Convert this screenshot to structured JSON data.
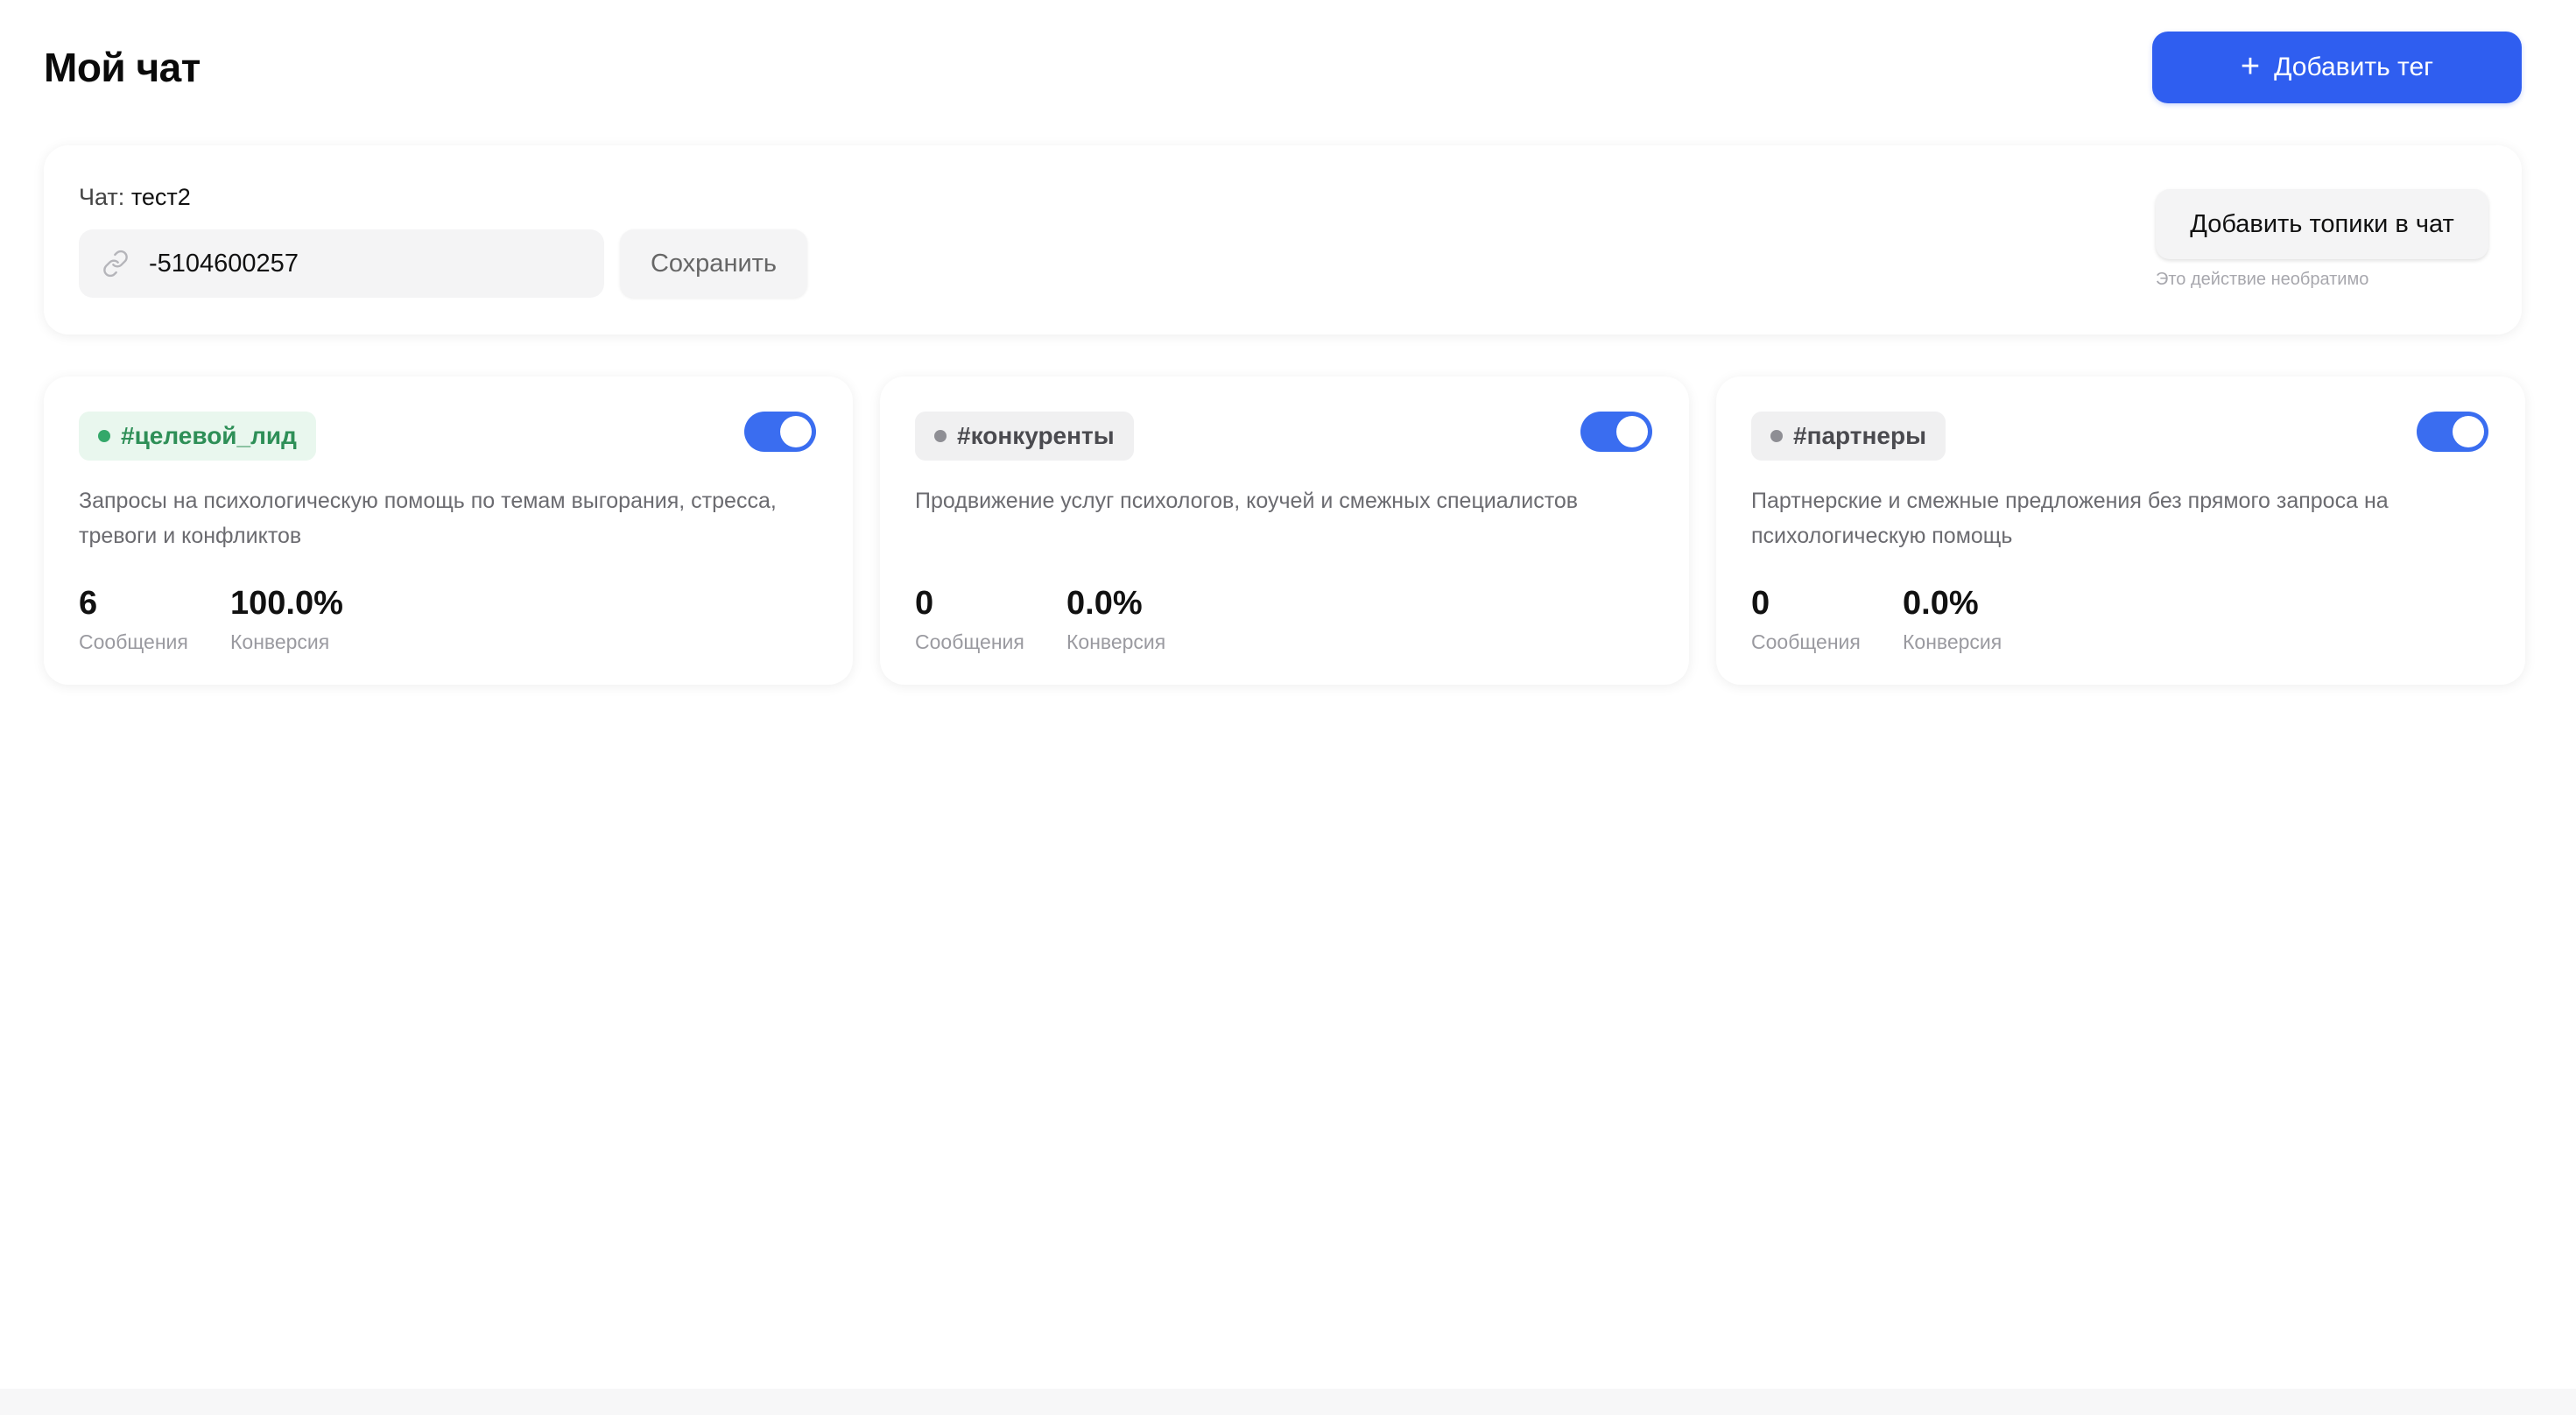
{
  "header": {
    "title": "Мой чат",
    "add_tag_label": "Добавить тег"
  },
  "chat": {
    "label_prefix": "Чат:",
    "name": "тест2",
    "chat_id_value": "-5104600257",
    "save_label": "Сохранить",
    "add_topics_label": "Добавить топики в чат",
    "irreversible_note": "Это действие необратимо"
  },
  "tags": [
    {
      "name": "#целевой_лид",
      "color": "#34a86a",
      "enabled": true,
      "description": "Запросы на психологическую помощь по темам выгорания, стресса, тревоги и конфликтов",
      "messages_value": "6",
      "messages_label": "Сообщения",
      "conversion_value": "100.0%",
      "conversion_label": "Конверсия"
    },
    {
      "name": "#конкуренты",
      "color": "#8e8e94",
      "enabled": true,
      "description": "Продвижение услуг психологов, коучей и смежных специалистов",
      "messages_value": "0",
      "messages_label": "Сообщения",
      "conversion_value": "0.0%",
      "conversion_label": "Конверсия"
    },
    {
      "name": "#партнеры",
      "color": "#8e8e94",
      "enabled": true,
      "description": "Партнерские и смежные предложения без прямого запроса на психологическую помощь",
      "messages_value": "0",
      "messages_label": "Сообщения",
      "conversion_value": "0.0%",
      "conversion_label": "Конверсия"
    }
  ],
  "colors": {
    "accent": "#2f5ef0",
    "toggle_on": "#3a6df0"
  }
}
